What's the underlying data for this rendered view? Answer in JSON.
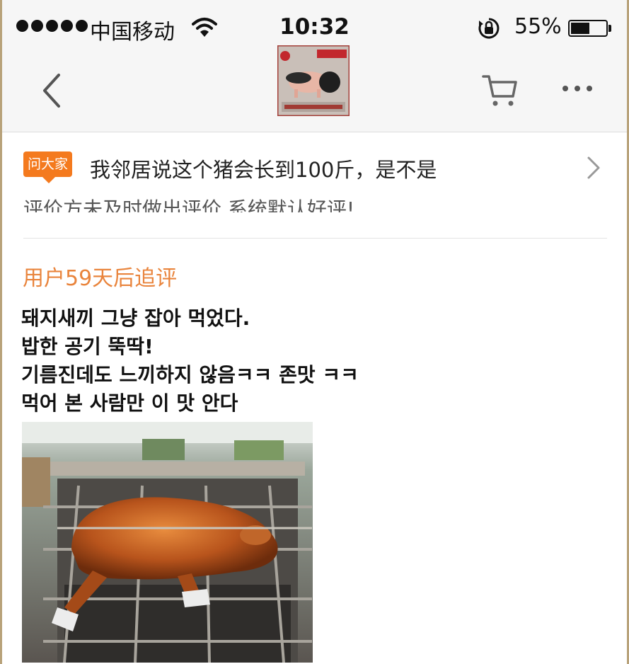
{
  "status_bar": {
    "carrier": "中国移动",
    "time": "10:32",
    "battery_percent": "55%",
    "battery_level": 0.55
  },
  "nav": {
    "back_icon": "chevron-left-icon",
    "product_thumbnail": "product-image",
    "cart_icon": "cart-icon",
    "more_icon": "ellipsis-icon"
  },
  "ask_banner": {
    "tag": "问大家",
    "question": "我邻居说这个猪会长到100斤，是不是"
  },
  "review": {
    "truncated_text": "评价方未及时做出评价,系统默认好评!",
    "followup_label": "用户59天后追评",
    "lines": [
      "돼지새끼 그냥 잡아 먹었다.",
      "밥한 공기 뚝딱!",
      "기름진데도 느끼하지 않음ㅋㅋ 존맛 ㅋㅋ",
      "먹어 본 사람만 이 맛 안다"
    ]
  },
  "colors": {
    "accent": "#f47a1e",
    "followup": "#e9843c"
  }
}
